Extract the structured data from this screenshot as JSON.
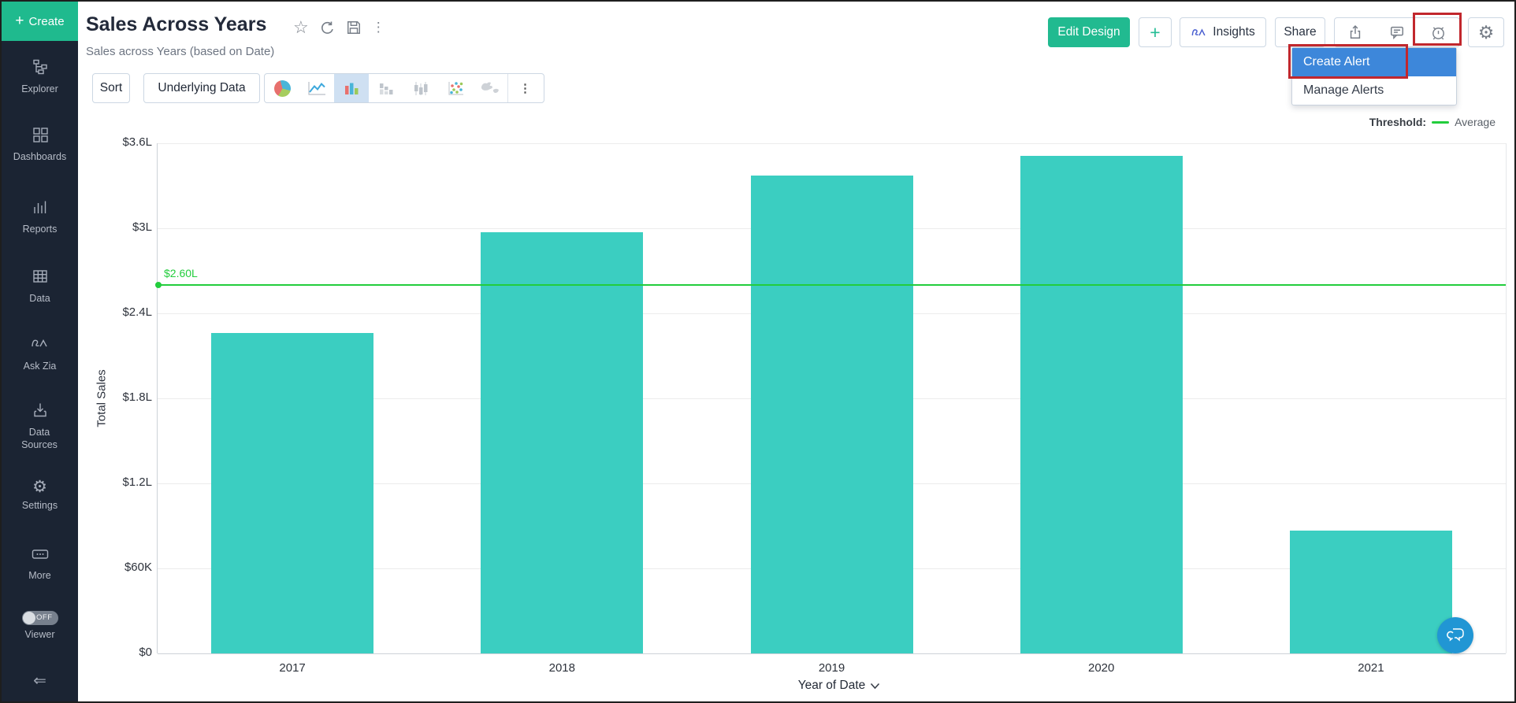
{
  "sidebar": {
    "create": {
      "label": "Create"
    },
    "items": [
      {
        "label": "Explorer",
        "icon": "explorer-icon"
      },
      {
        "label": "Dashboards",
        "icon": "dashboards-icon"
      },
      {
        "label": "Reports",
        "icon": "reports-icon"
      },
      {
        "label": "Data",
        "icon": "data-icon"
      },
      {
        "label": "Ask Zia",
        "icon": "zia-icon"
      },
      {
        "label": "Data Sources",
        "icon": "data-sources-icon"
      },
      {
        "label": "Settings",
        "icon": "settings-gear-icon"
      },
      {
        "label": "More",
        "icon": "more-ellipsis-icon"
      }
    ],
    "viewer": {
      "label": "Viewer",
      "toggle_state": "OFF"
    }
  },
  "header": {
    "title": "Sales Across Years",
    "subtitle": "Sales across Years (based on Date)",
    "title_icons": [
      "star-icon",
      "refresh-icon",
      "save-icon",
      "kebab-menu-icon"
    ],
    "buttons": {
      "edit_design": "Edit Design",
      "plus": "+",
      "insights": "Insights",
      "share": "Share"
    },
    "icon_buttons": [
      "export-icon",
      "comment-icon",
      "alarm-icon",
      "gear-icon"
    ]
  },
  "alert_menu": {
    "items": [
      {
        "label": "Create Alert",
        "selected": true
      },
      {
        "label": "Manage Alerts",
        "selected": false
      }
    ]
  },
  "toolbar": {
    "sort": "Sort",
    "underlying_data": "Underlying Data",
    "chart_type_icons": [
      "pie",
      "line",
      "bar",
      "stacked-bar",
      "grouped-bar",
      "scatter",
      "map",
      "more"
    ],
    "selected_chart_type": "bar"
  },
  "chart_data": {
    "type": "bar",
    "categories": [
      "2017",
      "2018",
      "2019",
      "2020",
      "2021"
    ],
    "values": [
      226000,
      297000,
      337000,
      351000,
      86500
    ],
    "xlabel": "Year of Date",
    "ylabel": "Total Sales",
    "ylim": [
      0,
      360000
    ],
    "yticks": [
      {
        "value": 0,
        "label": "$0"
      },
      {
        "value": 60000,
        "label": "$60K"
      },
      {
        "value": 120000,
        "label": "$1.2L"
      },
      {
        "value": 180000,
        "label": "$1.8L"
      },
      {
        "value": 240000,
        "label": "$2.4L"
      },
      {
        "value": 300000,
        "label": "$3L"
      },
      {
        "value": 360000,
        "label": "$3.6L"
      }
    ],
    "grid": true,
    "bar_color": "#3bcec1",
    "threshold": {
      "value": 260000,
      "label": "$2.60L",
      "color": "#22cd3c",
      "legend_title": "Threshold:",
      "legend_label": "Average"
    },
    "legend_position": "top-right"
  },
  "colors": {
    "accent_teal": "#1fba8e",
    "sidebar_bg": "#1b2433",
    "menu_selected_blue": "#3d87da",
    "annotation_red": "#c1272d",
    "chat_fab_blue": "#2196d4"
  }
}
